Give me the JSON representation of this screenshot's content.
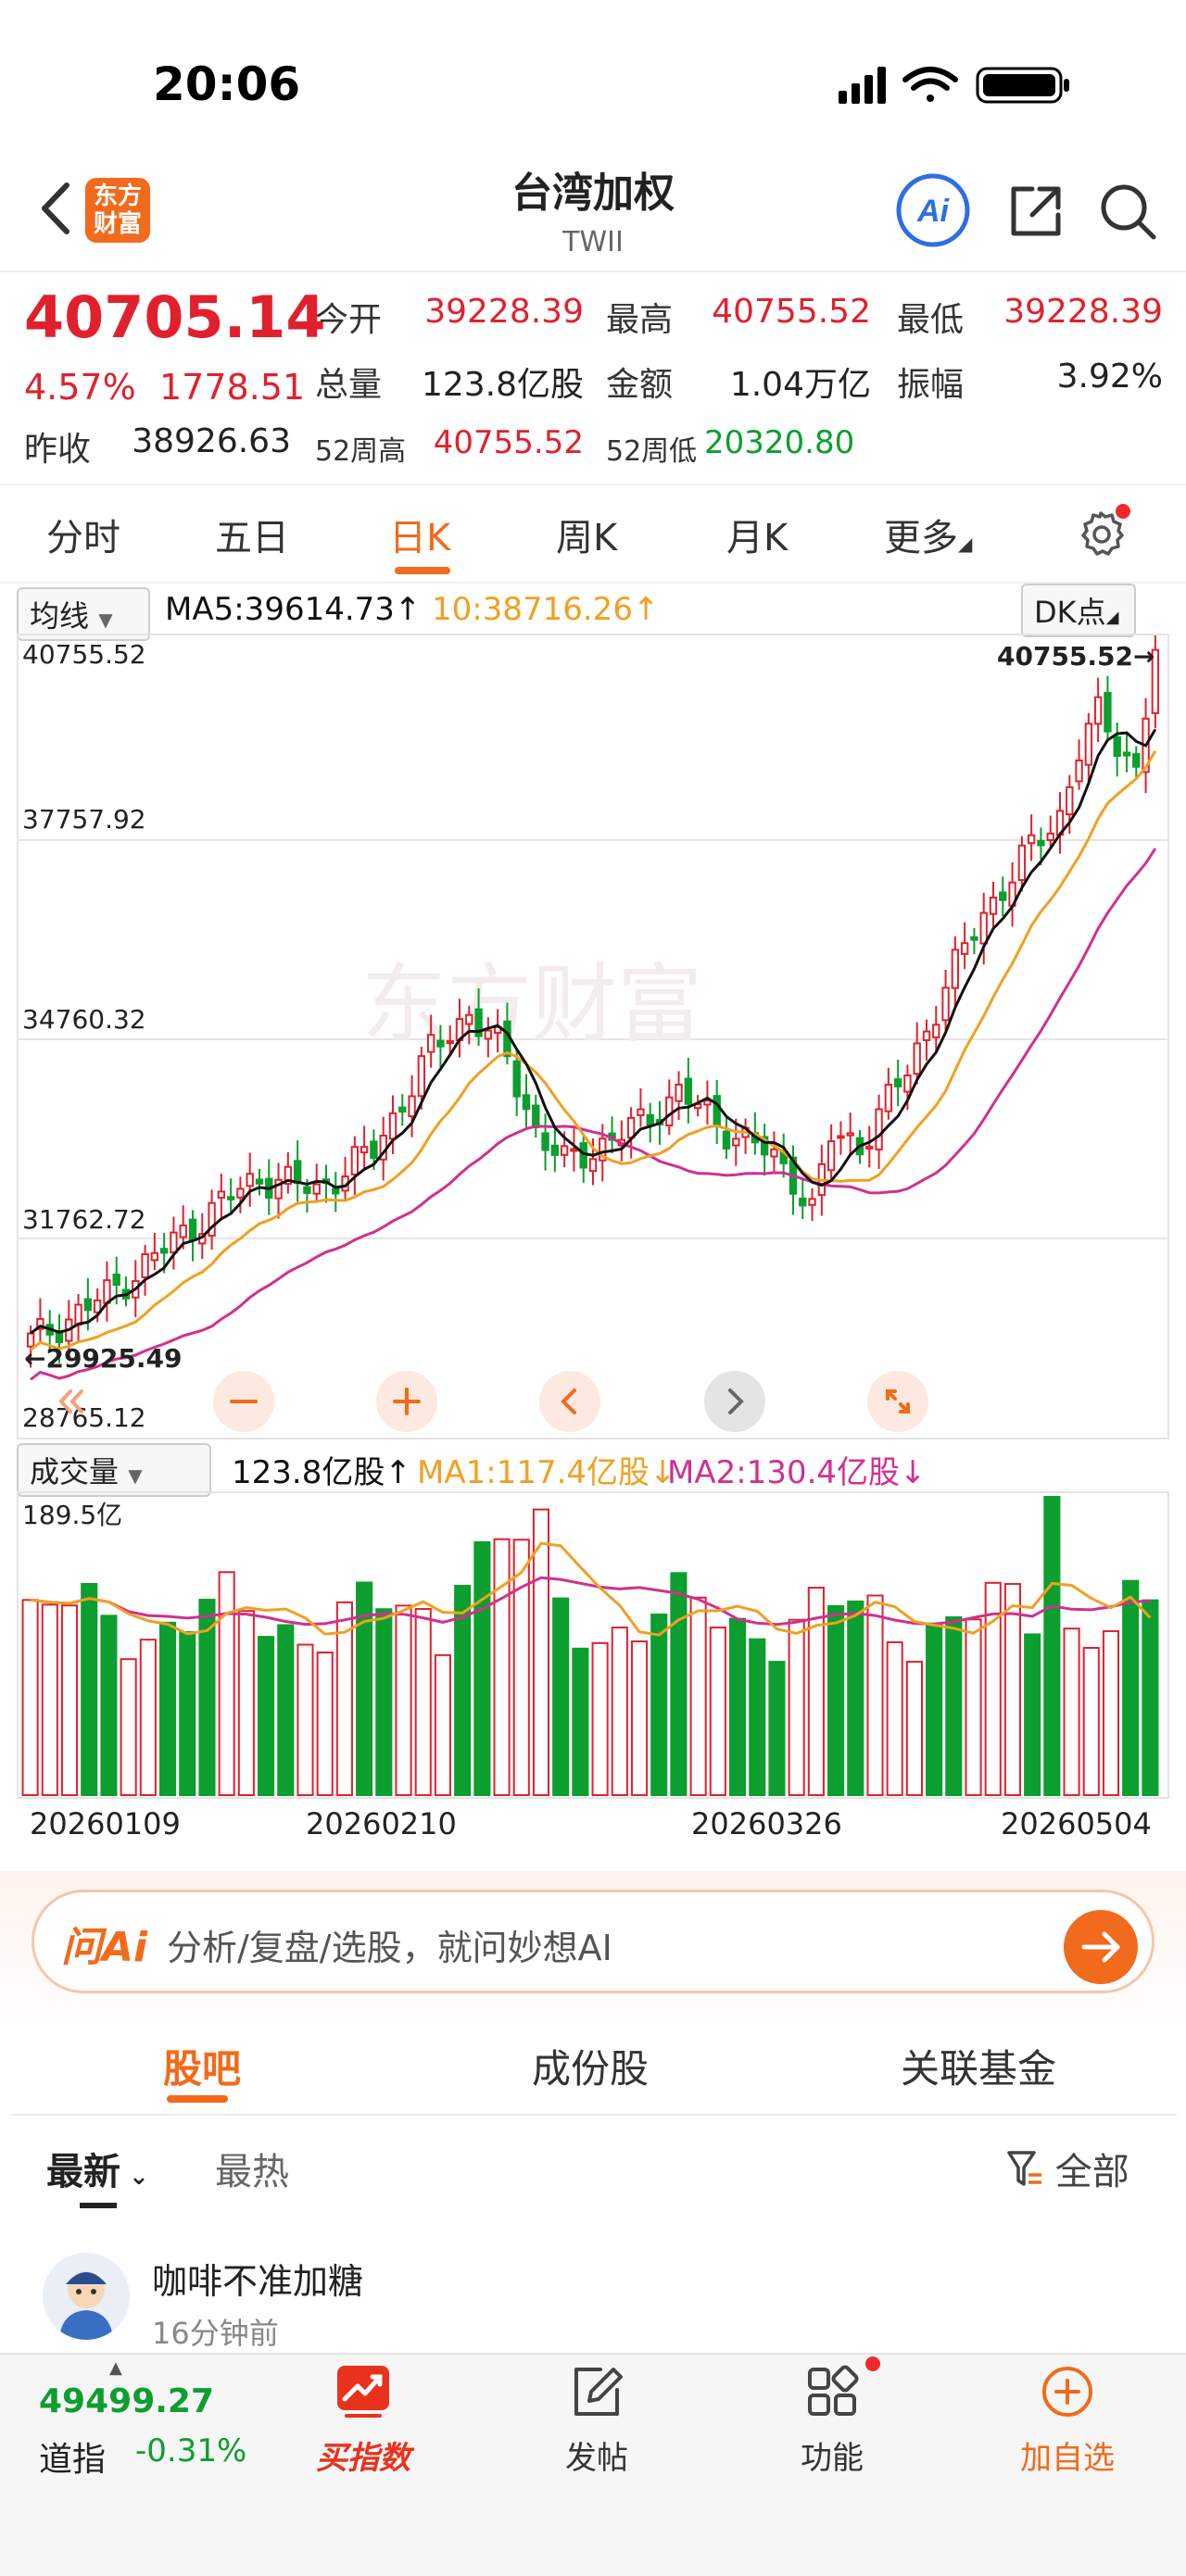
{
  "status_bar": {
    "time": "20:06"
  },
  "header": {
    "title": "台湾加权",
    "subtitle": "TWII",
    "logo_text_line1": "东方",
    "logo_text_line2": "财富",
    "ai_label": "Ai"
  },
  "quote": {
    "last": "40705.14",
    "change_pct": "4.57%",
    "change_abs": "1778.51",
    "open_label": "今开",
    "open": "39228.39",
    "high_label": "最高",
    "high": "40755.52",
    "low_label": "最低",
    "low": "39228.39",
    "volume_label": "总量",
    "volume": "123.8亿股",
    "amount_label": "金额",
    "amount": "1.04万亿",
    "amplitude_label": "振幅",
    "amplitude": "3.92%",
    "prev_close_label": "昨收",
    "prev_close": "38926.63",
    "week52_high_label": "52周高",
    "week52_high": "40755.52",
    "week52_low_label": "52周低",
    "week52_low": "20320.80"
  },
  "period_tabs": [
    "分时",
    "五日",
    "日K",
    "周K",
    "月K",
    "更多"
  ],
  "ma_legend": {
    "selector": "均线",
    "ma5": "MA5:39614.73↑",
    "ma10": "10:38716.26↑",
    "dk": "DK点"
  },
  "kline": {
    "y_labels": [
      "40755.52",
      "37757.92",
      "34760.32",
      "31762.72",
      "28765.12"
    ],
    "high_marker": "40755.52→",
    "low_marker": "←29925.49",
    "colors": {
      "up": "#e0212d",
      "down": "#0c9e2e",
      "ma5": "#111111",
      "ma10": "#f0a023",
      "ma20": "#d0308f"
    }
  },
  "volume_legend": {
    "selector": "成交量",
    "current": "123.8亿股↑",
    "ma1": "MA1:117.4亿股↓",
    "ma2": "MA2:130.4亿股↓",
    "max_label": "189.5亿"
  },
  "dates": [
    "20260109",
    "20260210",
    "20260326",
    "20260504"
  ],
  "ai_bar": {
    "logo": "问Ai",
    "placeholder": "分析/复盘/选股，就问妙想AI"
  },
  "community_tabs": [
    "股吧",
    "成份股",
    "关联基金"
  ],
  "sort": {
    "latest": "最新",
    "hot": "最热",
    "filter": "全部"
  },
  "post": {
    "user": "咖啡不准加糖",
    "time": "16分钟前"
  },
  "bottom_bar": {
    "index_value": "49499.27",
    "index_name": "道指",
    "index_change": "-0.31%",
    "items": [
      "买指数",
      "发帖",
      "功能",
      "加自选"
    ]
  }
}
